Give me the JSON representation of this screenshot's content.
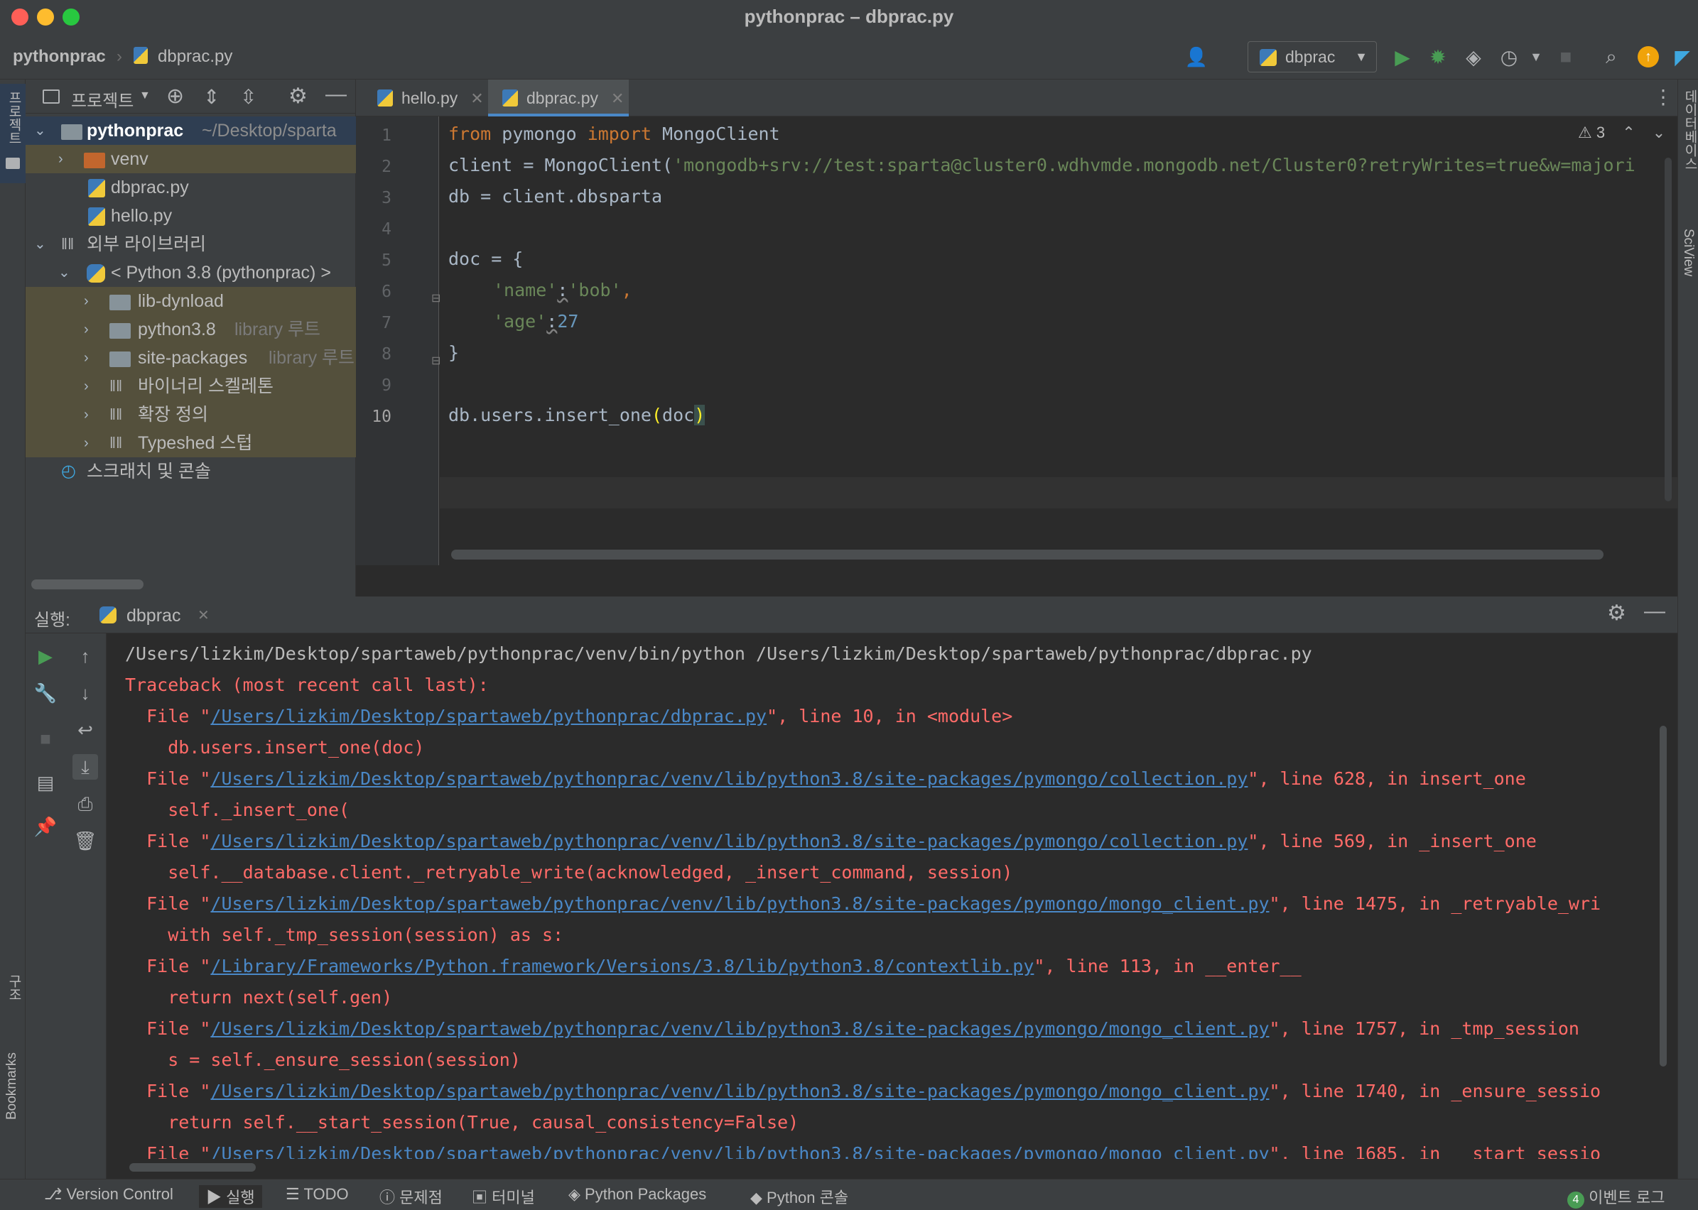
{
  "window": {
    "title": "pythonprac – dbprac.py"
  },
  "navbar": {
    "crumb_project": "pythonprac",
    "crumb_file": "dbprac.py",
    "run_config": "dbprac"
  },
  "project_panel": {
    "view_label": "프로젝트",
    "tree": [
      {
        "label": "pythonprac",
        "hint": "~/Desktop/sparta"
      },
      {
        "label": "venv"
      },
      {
        "label": "dbprac.py"
      },
      {
        "label": "hello.py"
      },
      {
        "label": "외부 라이브러리"
      },
      {
        "label": "< Python 3.8 (pythonprac) >"
      },
      {
        "label": "lib-dynload"
      },
      {
        "label": "python3.8",
        "hint": "library 루트"
      },
      {
        "label": "site-packages",
        "hint": "library 루트"
      },
      {
        "label": "바이너리 스켈레톤"
      },
      {
        "label": "확장 정의"
      },
      {
        "label": "Typeshed 스텁"
      },
      {
        "label": "스크래치 및 콘솔"
      }
    ]
  },
  "editor": {
    "tabs": [
      {
        "label": "hello.py"
      },
      {
        "label": "dbprac.py"
      }
    ],
    "warnings_count": "3",
    "line_numbers": [
      "1",
      "2",
      "3",
      "4",
      "5",
      "6",
      "7",
      "8",
      "9",
      "10"
    ],
    "code": {
      "l1a": "from",
      "l1b": " pymongo ",
      "l1c": "import",
      "l1d": " MongoClient",
      "l2a": "client = MongoClient(",
      "l2b": "'mongodb+srv://test:sparta@cluster0.wdhvmde.mongodb.net/Cluster0?retryWrites=true&w=majori",
      "l3": "db = client.dbsparta",
      "l5": "doc = {",
      "l6a": "'name'",
      "l6b": ":",
      "l6c": "'bob'",
      "l6d": ",",
      "l7a": "'age'",
      "l7b": ":",
      "l7c": "27",
      "l8": "}",
      "l10a": "db.users.insert_one",
      "l10b": "(",
      "l10c": "doc",
      "l10d": ")"
    }
  },
  "right_strip": {
    "db_label": "데이터베이스",
    "sciview_label": "SciView"
  },
  "left_strip": {
    "project_label": "프로젝트",
    "structure_label": "구조",
    "bookmarks_label": "Bookmarks"
  },
  "run_panel": {
    "prefix": "실행:",
    "tab_label": "dbprac",
    "lines": [
      {
        "t": "plain",
        "text": "/Users/lizkim/Desktop/spartaweb/pythonprac/venv/bin/python /Users/lizkim/Desktop/spartaweb/pythonprac/dbprac.py"
      },
      {
        "t": "err",
        "text": "Traceback (most recent call last):"
      },
      {
        "t": "file",
        "pre": "  File \"",
        "link": "/Users/lizkim/Desktop/spartaweb/pythonprac/dbprac.py",
        "post": "\", line 10, in <module>"
      },
      {
        "t": "err",
        "text": "    db.users.insert_one(doc)"
      },
      {
        "t": "file",
        "pre": "  File \"",
        "link": "/Users/lizkim/Desktop/spartaweb/pythonprac/venv/lib/python3.8/site-packages/pymongo/collection.py",
        "post": "\", line 628, in insert_one"
      },
      {
        "t": "err",
        "text": "    self._insert_one("
      },
      {
        "t": "file",
        "pre": "  File \"",
        "link": "/Users/lizkim/Desktop/spartaweb/pythonprac/venv/lib/python3.8/site-packages/pymongo/collection.py",
        "post": "\", line 569, in _insert_one"
      },
      {
        "t": "err",
        "text": "    self.__database.client._retryable_write(acknowledged, _insert_command, session)"
      },
      {
        "t": "file",
        "pre": "  File \"",
        "link": "/Users/lizkim/Desktop/spartaweb/pythonprac/venv/lib/python3.8/site-packages/pymongo/mongo_client.py",
        "post": "\", line 1475, in _retryable_wri"
      },
      {
        "t": "err",
        "text": "    with self._tmp_session(session) as s:"
      },
      {
        "t": "file",
        "pre": "  File \"",
        "link": "/Library/Frameworks/Python.framework/Versions/3.8/lib/python3.8/contextlib.py",
        "post": "\", line 113, in __enter__"
      },
      {
        "t": "err",
        "text": "    return next(self.gen)"
      },
      {
        "t": "file",
        "pre": "  File \"",
        "link": "/Users/lizkim/Desktop/spartaweb/pythonprac/venv/lib/python3.8/site-packages/pymongo/mongo_client.py",
        "post": "\", line 1757, in _tmp_session"
      },
      {
        "t": "err",
        "text": "    s = self._ensure_session(session)"
      },
      {
        "t": "file",
        "pre": "  File \"",
        "link": "/Users/lizkim/Desktop/spartaweb/pythonprac/venv/lib/python3.8/site-packages/pymongo/mongo_client.py",
        "post": "\", line 1740, in _ensure_sessio"
      },
      {
        "t": "err",
        "text": "    return self.__start_session(True, causal_consistency=False)"
      },
      {
        "t": "file",
        "pre": "  File \"",
        "link": "/Users/lizkim/Desktop/spartaweb/pythonprac/venv/lib/python3.8/site-packages/pymongo/mongo_client.py",
        "post": "\", line 1685, in __start_sessio"
      }
    ]
  },
  "status_bar": {
    "version_control": "Version Control",
    "run": "실행",
    "todo": "TODO",
    "problems": "문제점",
    "terminal": "터미널",
    "python_packages": "Python Packages",
    "python_console": "Python 콘솔",
    "event_count": "4",
    "event_log": "이벤트 로그"
  },
  "colors": {
    "background": "#2b2b2b",
    "panel": "#3c3f41",
    "keyword": "#cc7832",
    "string": "#6a8759",
    "number": "#6897bb",
    "error_text": "#ff6b68",
    "link": "#4a88c7"
  }
}
